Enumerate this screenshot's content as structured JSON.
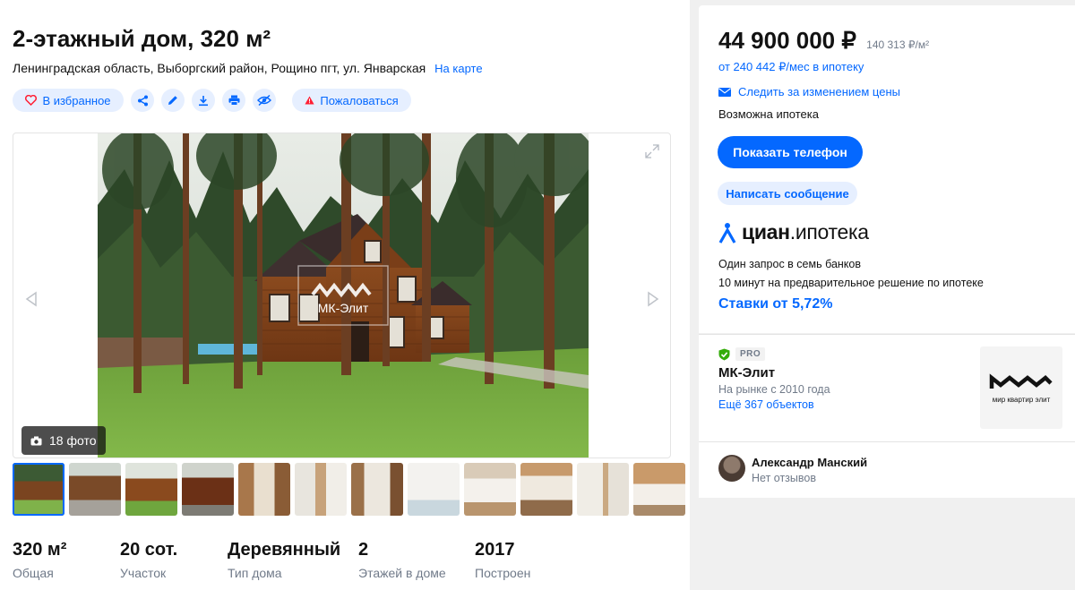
{
  "listing": {
    "title": "2-этажный дом, 320 м²",
    "address": "Ленинградская область, Выборгский район, Рощино пгт, ул. Январская",
    "map_link": "На карте"
  },
  "actions": {
    "favorite_label": "В избранное",
    "icons": [
      "share-icon",
      "edit-icon",
      "download-icon",
      "print-icon",
      "hide-icon"
    ],
    "complain_label": "Пожаловаться"
  },
  "gallery": {
    "photo_count_label": "18 фото",
    "watermark": "МК-Элит",
    "thumbnails_visible": 12,
    "active_thumbnail": 1
  },
  "facts": [
    {
      "value": "320 м²",
      "label": "Общая"
    },
    {
      "value": "20 сот.",
      "label": "Участок"
    },
    {
      "value": "Деревянный",
      "label": "Тип дома"
    },
    {
      "value": "2",
      "label": "Этажей в доме"
    },
    {
      "value": "2017",
      "label": "Построен"
    }
  ],
  "price": {
    "total": "44 900 000 ₽",
    "per_sqm": "140 313 ₽/м²",
    "mortgage_from": "от 240 442 ₽/мес в ипотеку",
    "follow_label": "Следить за изменением цены",
    "mortgage_possible": "Возможна ипотека"
  },
  "contact": {
    "phone_button": "Показать телефон",
    "message_button": "Написать сообщение"
  },
  "cian_mortgage": {
    "brand": "циан",
    "product": "ипотека",
    "line1": "Один запрос в семь банков",
    "line2": "10 минут на предварительное решение по ипотеке",
    "rates_link": "Ставки от 5,72%"
  },
  "agency": {
    "badge": "PRO",
    "name": "МК-Элит",
    "since": "На рынке с 2010 года",
    "more_link": "Ещё 367 объектов",
    "logo_tagline": "мир квартир элит"
  },
  "agent": {
    "name": "Александр Манский",
    "reviews": "Нет отзывов"
  },
  "colors": {
    "accent": "#0468ff",
    "accent_light": "#e6efff",
    "text": "#121212",
    "muted": "#707a89",
    "danger": "#ff1f34"
  }
}
